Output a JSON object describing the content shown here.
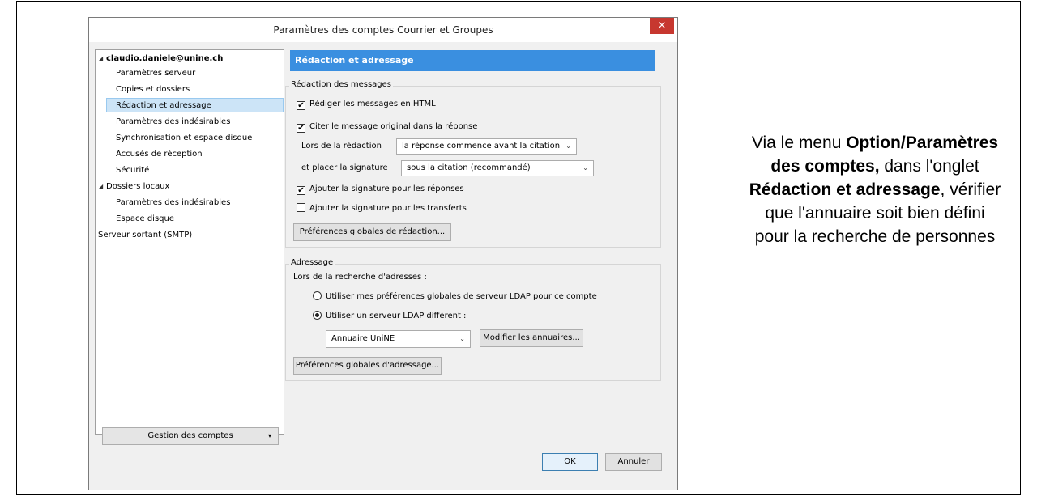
{
  "dialog": {
    "title": "Paramètres des comptes Courrier et Groupes",
    "close_glyph": "×"
  },
  "sidebar": {
    "items": [
      {
        "label": "claudio.daniele@unine.ch",
        "arrow": "◢"
      },
      {
        "label": "Paramètres serveur"
      },
      {
        "label": "Copies et dossiers"
      },
      {
        "label": "Rédaction et adressage"
      },
      {
        "label": "Paramètres des indésirables"
      },
      {
        "label": "Synchronisation et espace disque"
      },
      {
        "label": "Accusés de réception"
      },
      {
        "label": "Sécurité"
      },
      {
        "label": "Dossiers locaux",
        "arrow": "◢"
      },
      {
        "label": "Paramètres des indésirables"
      },
      {
        "label": "Espace disque"
      },
      {
        "label": "Serveur sortant (SMTP)"
      }
    ],
    "manage_button": "Gestion des comptes",
    "manage_caret": "▾"
  },
  "panel": {
    "header": "Rédaction et adressage",
    "composition": {
      "group_label": "Rédaction des messages",
      "html_label": "Rédiger les messages en HTML",
      "html_checked": true,
      "quote_label": "Citer le message original dans la réponse",
      "quote_checked": true,
      "reply_label": "Lors de la rédaction",
      "reply_value": "la réponse commence avant la citation",
      "signature_label": "et placer la signature",
      "signature_value": "sous la citation (recommandé)",
      "sig_replies_label": "Ajouter la signature pour les réponses",
      "sig_replies_checked": true,
      "sig_forwards_label": "Ajouter la signature pour les transferts",
      "sig_forwards_checked": false,
      "global_button": "Préférences globales de rédaction..."
    },
    "addressing": {
      "group_label": "Adressage",
      "lookup_label": "Lors de la recherche d'adresses :",
      "option_global": "Utiliser mes préférences globales de serveur LDAP pour ce compte",
      "option_different": "Utiliser un serveur LDAP différent :",
      "selected_option": "different",
      "directory_value": "Annuaire UniNE",
      "edit_button": "Modifier les annuaires...",
      "global_button": "Préférences globales d'adressage..."
    }
  },
  "footer": {
    "ok": "OK",
    "cancel": "Annuler"
  },
  "caption": {
    "part1": "Via le menu ",
    "bold1": "Option/Paramètres des comptes,",
    "part2": " dans l'onglet ",
    "bold2": "Rédaction et adressage",
    "part3": ", vérifier que l'annuaire soit bien défini pour la recherche de personnes"
  },
  "check_glyph": "✔",
  "chevron_glyph": "⌄"
}
